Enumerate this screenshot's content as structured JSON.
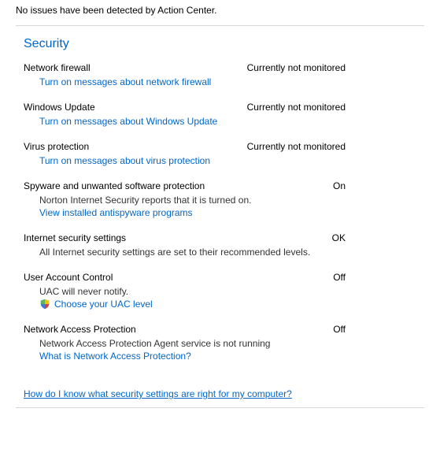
{
  "top_status": "No issues have been detected by Action Center.",
  "section_title": "Security",
  "items": [
    {
      "title": "Network firewall",
      "status": "Currently not monitored",
      "link": "Turn on messages about network firewall"
    },
    {
      "title": "Windows Update",
      "status": "Currently not monitored",
      "link": "Turn on messages about Windows Update"
    },
    {
      "title": "Virus protection",
      "status": "Currently not monitored",
      "link": "Turn on messages about virus protection"
    },
    {
      "title": "Spyware and unwanted software protection",
      "status": "On",
      "detail": "Norton Internet Security reports that it is turned on.",
      "link": "View installed antispyware programs"
    },
    {
      "title": "Internet security settings",
      "status": "OK",
      "detail": "All Internet security settings are set to their recommended levels."
    },
    {
      "title": "User Account Control",
      "status": "Off",
      "detail": "UAC will never notify.",
      "shield_link": "Choose your UAC level"
    },
    {
      "title": "Network Access Protection",
      "status": "Off",
      "detail": "Network Access Protection Agent service is not running",
      "link": "What is Network Access Protection?"
    }
  ],
  "bottom_link": "How do I know what security settings are right for my computer?"
}
